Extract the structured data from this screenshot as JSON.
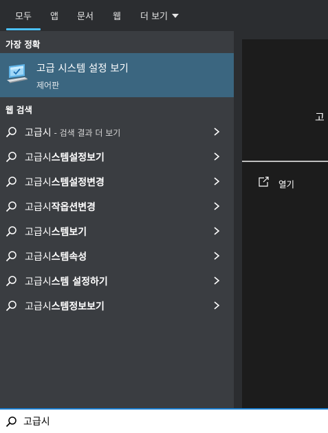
{
  "tabs": [
    {
      "label": "모두",
      "active": true
    },
    {
      "label": "앱"
    },
    {
      "label": "문서"
    },
    {
      "label": "웹"
    },
    {
      "label": "더 보기"
    }
  ],
  "best_match": {
    "heading": "가장 정확",
    "title": "고급 시스템 설정 보기",
    "subtitle": "제어판",
    "icon": "computer-settings-icon"
  },
  "web_search": {
    "heading": "웹 검색",
    "first": {
      "query": "고급시",
      "suffix": " - 검색 결과 더 보기"
    },
    "items": [
      {
        "prefix": "고급시",
        "rest": "스템설정보기"
      },
      {
        "prefix": "고급시",
        "rest": "스템설정변경"
      },
      {
        "prefix": "고급시",
        "rest": "작옵션변경"
      },
      {
        "prefix": "고급시",
        "rest": "스템보기"
      },
      {
        "prefix": "고급시",
        "rest": "스템속성"
      },
      {
        "prefix": "고급시",
        "rest": "스템 설정하기"
      },
      {
        "prefix": "고급시",
        "rest": "스템정보보기"
      }
    ]
  },
  "preview": {
    "title_clip": "고",
    "open_label": "열기"
  },
  "search": {
    "value": "고급시"
  },
  "colors": {
    "accent": "#4cc2ff",
    "selected_bg": "#3b6680",
    "pane_bg": "#3a3d41",
    "search_border": "#1b7fd1"
  }
}
